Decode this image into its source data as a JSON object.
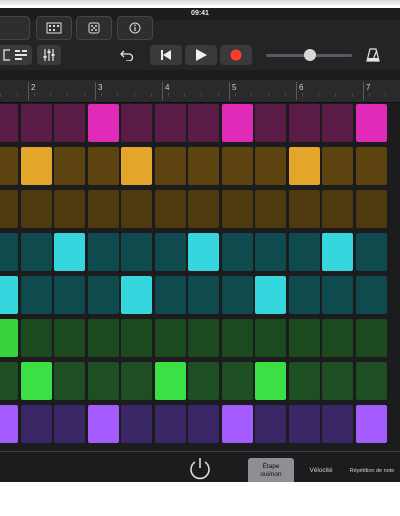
{
  "status": {
    "time": "09:41"
  },
  "ruler": {
    "bars": [
      "2",
      "3",
      "4",
      "5",
      "6",
      "7"
    ]
  },
  "bottom": {
    "segments": [
      "Étape\noui/non",
      "Vélocité",
      "Répétition de note"
    ],
    "active_segment": 0
  },
  "colors": {
    "background": "#1c1c1e",
    "record": "#ff3b30",
    "rows": [
      "#c2168f",
      "#c98e10",
      "#7d5a0c",
      "#0fb8c0",
      "#1cc6cc",
      "#2cc92c",
      "#33d43a",
      "#9b4cff"
    ]
  },
  "pattern": {
    "rows": [
      {
        "name": "row-1",
        "lit": [
          3,
          7,
          11
        ],
        "base": "#5a1c46",
        "on": "#e02ab8"
      },
      {
        "name": "row-2",
        "lit": [
          1,
          4,
          9
        ],
        "base": "#5c4310",
        "on": "#e3a52a"
      },
      {
        "name": "row-3",
        "lit": [],
        "base": "#4e3a0e",
        "on": "#e3a52a"
      },
      {
        "name": "row-4",
        "lit": [
          2,
          6,
          10
        ],
        "base": "#0f4a4e",
        "on": "#35d6dd"
      },
      {
        "name": "row-5",
        "lit": [
          0,
          4,
          8
        ],
        "base": "#0f4a4e",
        "on": "#35d6dd"
      },
      {
        "name": "row-6",
        "lit": [
          0
        ],
        "base": "#1c4a1f",
        "on": "#38d43d"
      },
      {
        "name": "row-7",
        "lit": [
          1,
          5,
          8
        ],
        "base": "#1e4f22",
        "on": "#3be144"
      },
      {
        "name": "row-8",
        "lit": [
          0,
          3,
          7,
          11
        ],
        "base": "#3a2866",
        "on": "#a45cff"
      }
    ]
  }
}
